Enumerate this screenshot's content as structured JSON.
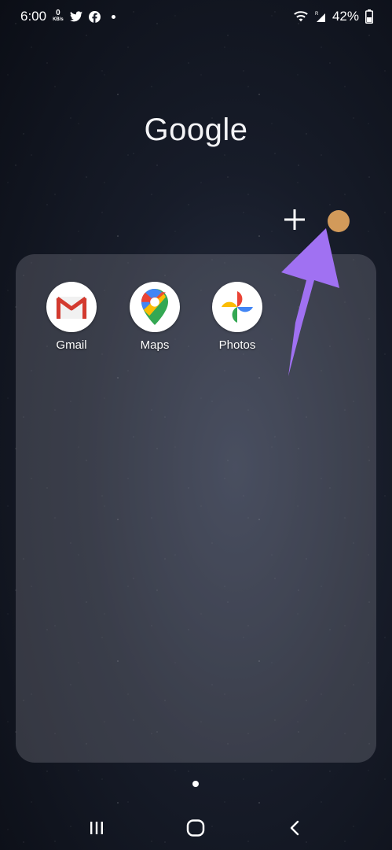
{
  "status_bar": {
    "time": "6:00",
    "net_speed_value": "0",
    "net_speed_unit": "KB/s",
    "battery": "42%",
    "icons": [
      "twitter-icon",
      "facebook-icon",
      "wifi-icon",
      "signal-icon",
      "battery-icon"
    ]
  },
  "folder": {
    "title": "Google",
    "apps": [
      {
        "label": "Gmail",
        "icon": "gmail-icon"
      },
      {
        "label": "Maps",
        "icon": "maps-icon"
      },
      {
        "label": "Photos",
        "icon": "photos-icon"
      }
    ],
    "color": "#d29a5a"
  },
  "annotation": {
    "arrow_color": "#a071f2"
  },
  "nav": {
    "icons": [
      "recents-icon",
      "home-icon",
      "back-icon"
    ]
  }
}
